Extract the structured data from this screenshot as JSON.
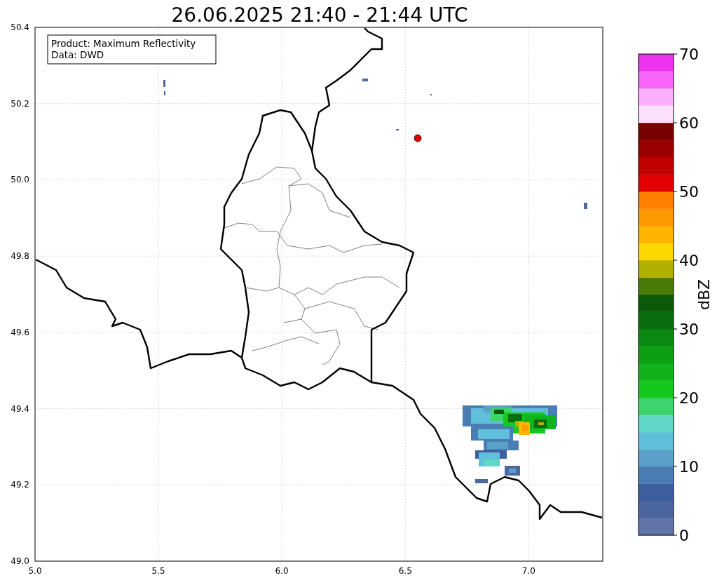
{
  "title": "26.06.2025 21:40 - 21:44 UTC",
  "map": {
    "info_box": [
      "Product: Maximum Reflectivity",
      "Data: DWD"
    ],
    "xticks": [
      "5.0",
      "5.5",
      "6.0",
      "6.5",
      "7.0"
    ],
    "yticks": [
      "50.4",
      "50.2",
      "50.0",
      "49.8",
      "49.6",
      "49.4",
      "49.2",
      "49.0"
    ]
  },
  "colorbar": {
    "label": "dBZ",
    "ticks": [
      "70",
      "60",
      "50",
      "40",
      "30",
      "20",
      "10",
      "0"
    ],
    "segments": [
      {
        "color": "#6074a8"
      },
      {
        "color": "#4c66a0"
      },
      {
        "color": "#3f5e9e"
      },
      {
        "color": "#4a7db4"
      },
      {
        "color": "#5aa0c8"
      },
      {
        "color": "#60c0dc"
      },
      {
        "color": "#60d8c8"
      },
      {
        "color": "#3cd46c"
      },
      {
        "color": "#14c81e"
      },
      {
        "color": "#10b41a"
      },
      {
        "color": "#0e9e14"
      },
      {
        "color": "#0a8a10"
      },
      {
        "color": "#0a6e10"
      },
      {
        "color": "#0a5a0a"
      },
      {
        "color": "#4a7a08"
      },
      {
        "color": "#b0b000"
      },
      {
        "color": "#ffd700"
      },
      {
        "color": "#ffb400"
      },
      {
        "color": "#ff9900"
      },
      {
        "color": "#ff7f00"
      },
      {
        "color": "#e20000"
      },
      {
        "color": "#c00000"
      },
      {
        "color": "#990000"
      },
      {
        "color": "#780000"
      },
      {
        "color": "#fde0fc"
      },
      {
        "color": "#fcb0fc"
      },
      {
        "color": "#f866f8"
      },
      {
        "color": "#ee33ee"
      }
    ]
  }
}
